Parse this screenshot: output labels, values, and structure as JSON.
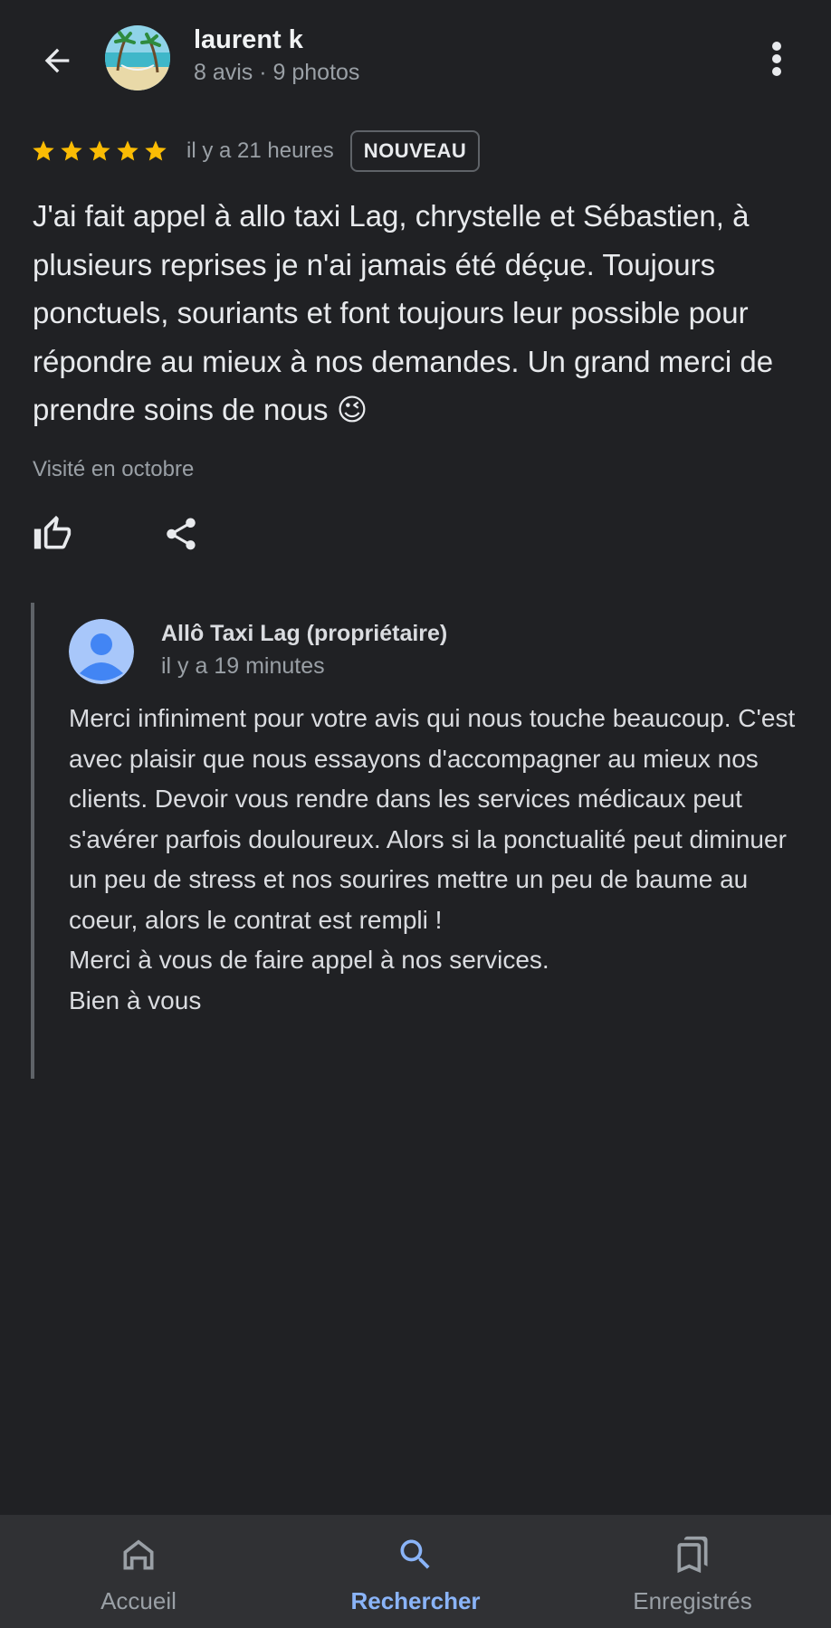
{
  "header": {
    "back_icon": "arrow-back-icon",
    "user_name": "laurent k",
    "user_meta": "8 avis · 9 photos",
    "menu_icon": "more-vert-icon"
  },
  "review": {
    "rating": 5,
    "max_rating": 5,
    "star_color": "#fbbc04",
    "time": "il y a 21 heures",
    "badge": "NOUVEAU",
    "text": "J'ai fait appel à allo taxi Lag, chrystelle et Sébastien, à plusieurs reprises je n'ai jamais été déçue. Toujours ponctuels, souriants et font toujours leur possible pour répondre au mieux à nos demandes. Un grand merci de prendre soins de nous 😉",
    "visited": "Visité en octobre",
    "like_icon": "thumb-up-icon",
    "share_icon": "share-icon"
  },
  "owner_reply": {
    "name": "Allô Taxi Lag (propriétaire)",
    "time": "il y a 19 minutes",
    "text": "Merci infiniment pour votre avis qui nous touche beaucoup. C'est avec plaisir que nous essayons d'accompagner au mieux nos clients. Devoir vous rendre dans les services médicaux peut s'avérer parfois douloureux. Alors si la ponctualité peut diminuer un peu de stress et nos sourires mettre un peu de baume au coeur, alors le contrat est rempli !\nMerci à vous de faire appel à nos services.\nBien à vous"
  },
  "bottom_nav": {
    "items": [
      {
        "label": "Accueil",
        "icon": "home-icon",
        "active": false
      },
      {
        "label": "Rechercher",
        "icon": "search-icon",
        "active": true
      },
      {
        "label": "Enregistrés",
        "icon": "bookmarks-icon",
        "active": false
      }
    ],
    "active_color": "#8ab4f8"
  }
}
